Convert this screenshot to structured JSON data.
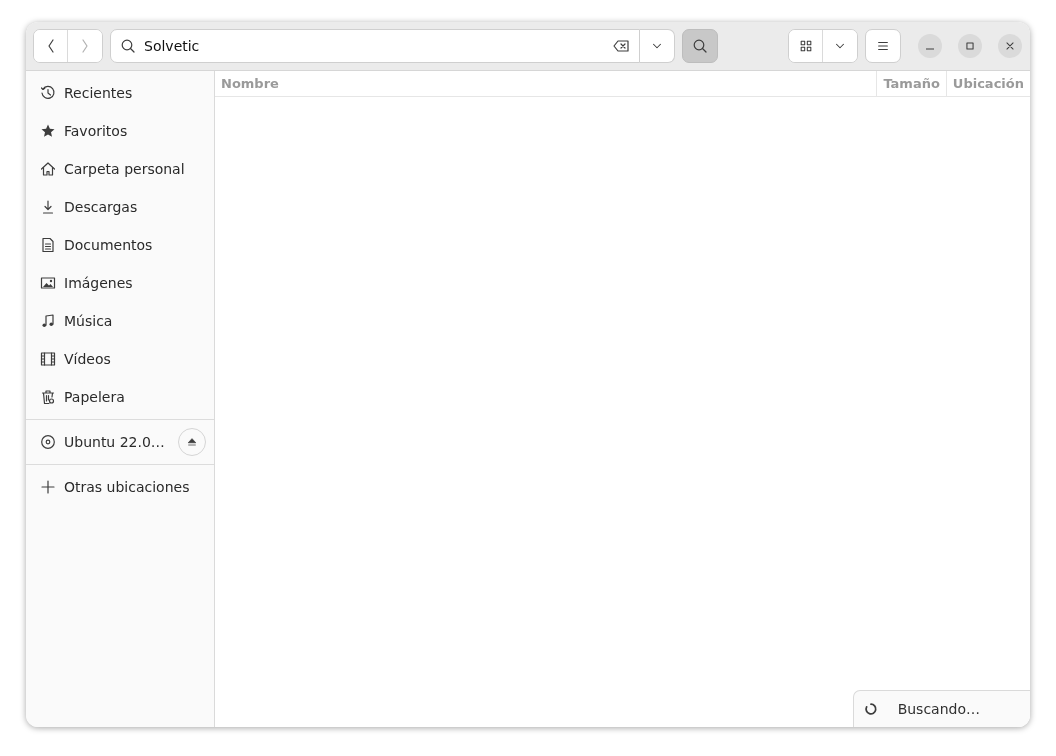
{
  "header": {
    "back": {
      "disabled": false
    },
    "forward": {
      "disabled": true
    },
    "search": {
      "value": "Solvetic"
    },
    "search_toggle": {
      "selected": true
    }
  },
  "sidebar": {
    "sections": [
      {
        "items": [
          {
            "label": "Recientes",
            "kind": "place",
            "selected": false
          },
          {
            "label": "Favoritos",
            "kind": "place",
            "selected": false
          },
          {
            "label": "Carpeta personal",
            "kind": "place",
            "selected": false
          },
          {
            "label": "Descargas",
            "kind": "place",
            "selected": false
          },
          {
            "label": "Documentos",
            "kind": "place",
            "selected": false
          },
          {
            "label": "Imágenes",
            "kind": "place",
            "selected": false
          },
          {
            "label": "Música",
            "kind": "place",
            "selected": false
          },
          {
            "label": "Vídeos",
            "kind": "place",
            "selected": false
          },
          {
            "label": "Papelera",
            "kind": "place",
            "selected": false
          }
        ]
      },
      {
        "items": [
          {
            "label": "Ubuntu 22.0…",
            "kind": "device",
            "selected": false
          }
        ]
      },
      {
        "items": [
          {
            "label": "Otras ubicaciones",
            "kind": "other",
            "selected": false
          }
        ]
      }
    ]
  },
  "table": {
    "columns": [
      "Nombre",
      "Tamaño",
      "Ubicación"
    ]
  },
  "status": {
    "text": "Buscando…"
  }
}
